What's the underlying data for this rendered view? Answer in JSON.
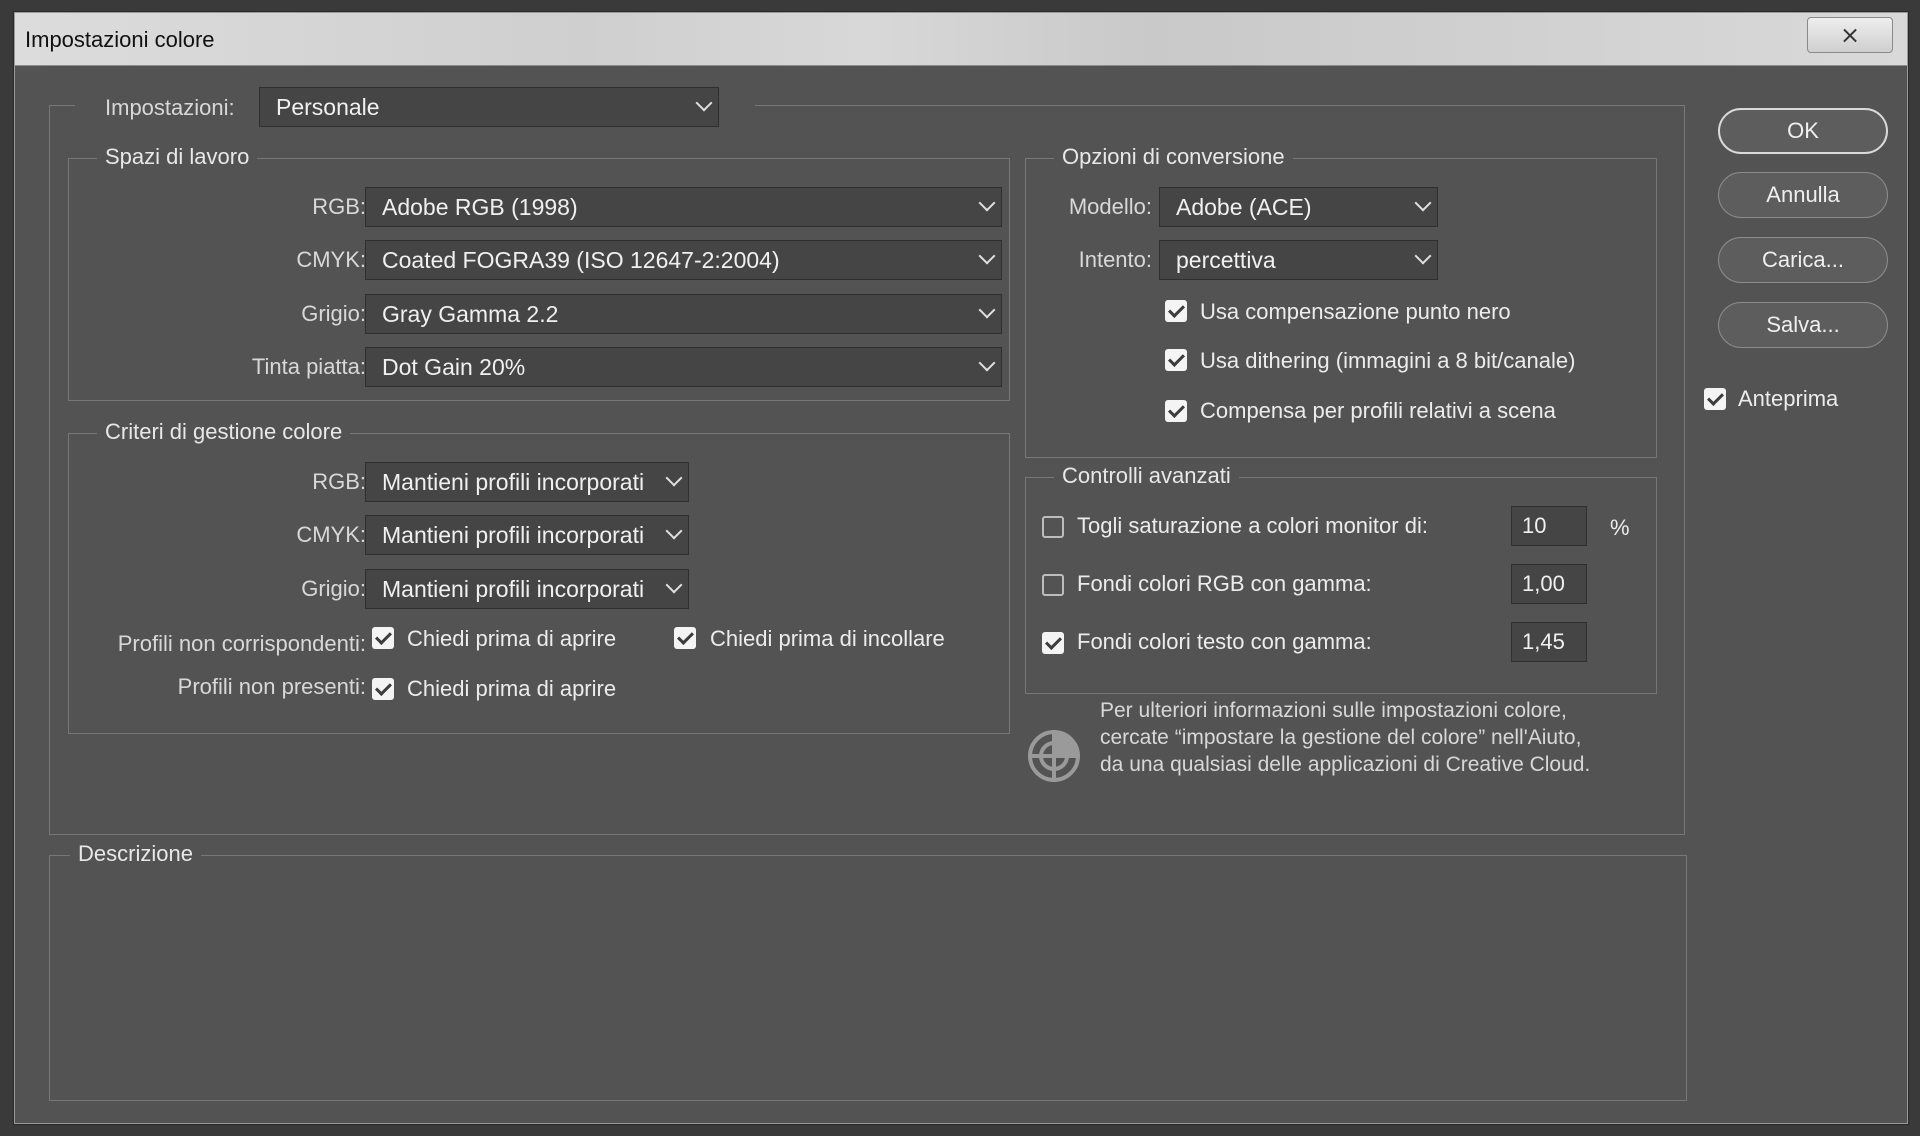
{
  "window": {
    "title": "Impostazioni colore",
    "close_glyph": "⨯"
  },
  "settings": {
    "label": "Impostazioni:",
    "value": "Personale"
  },
  "working_spaces": {
    "legend": "Spazi di lavoro",
    "rows": [
      {
        "label": "RGB:",
        "value": "Adobe RGB (1998)"
      },
      {
        "label": "CMYK:",
        "value": "Coated FOGRA39 (ISO 12647-2:2004)"
      },
      {
        "label": "Grigio:",
        "value": "Gray Gamma 2.2"
      },
      {
        "label": "Tinta piatta:",
        "value": "Dot Gain 20%"
      }
    ]
  },
  "policies": {
    "legend": "Criteri di gestione colore",
    "rows": [
      {
        "label": "RGB:",
        "value": "Mantieni profili incorporati"
      },
      {
        "label": "CMYK:",
        "value": "Mantieni profili incorporati"
      },
      {
        "label": "Grigio:",
        "value": "Mantieni profili incorporati"
      }
    ],
    "mismatch_label": "Profili non corrispondenti:",
    "mismatch_open": {
      "label": "Chiedi prima di aprire",
      "checked": true
    },
    "mismatch_paste": {
      "label": "Chiedi prima di incollare",
      "checked": true
    },
    "missing_label": "Profili non presenti:",
    "missing_open": {
      "label": "Chiedi prima di aprire",
      "checked": true
    }
  },
  "conversion": {
    "legend": "Opzioni di conversione",
    "engine_label": "Modello:",
    "engine_value": "Adobe (ACE)",
    "intent_label": "Intento:",
    "intent_value": "percettiva",
    "bpc": {
      "label": "Usa compensazione punto nero",
      "checked": true
    },
    "dither": {
      "label": "Usa dithering (immagini a 8 bit/canale)",
      "checked": true
    },
    "scene": {
      "label": "Compensa per profili relativi a scena",
      "checked": true
    }
  },
  "advanced": {
    "legend": "Controlli avanzati",
    "desaturate": {
      "label": "Togli saturazione a colori monitor di:",
      "checked": false,
      "value": "10",
      "unit": "%"
    },
    "blend_rgb": {
      "label": "Fondi colori RGB con gamma:",
      "checked": false,
      "value": "1,00"
    },
    "blend_text": {
      "label": "Fondi colori testo con gamma:",
      "checked": true,
      "value": "1,45"
    }
  },
  "info": {
    "lines": [
      "Per ulteriori informazioni sulle impostazioni colore,",
      "cercate “impostare la gestione del colore” nell'Aiuto,",
      "da una qualsiasi delle applicazioni di Creative Cloud."
    ],
    "icon": "color-wheel-icon"
  },
  "description": {
    "legend": "Descrizione"
  },
  "buttons": {
    "ok": "OK",
    "cancel": "Annulla",
    "load": "Carica...",
    "save": "Salva..."
  },
  "preview": {
    "label": "Anteprima",
    "checked": true
  }
}
